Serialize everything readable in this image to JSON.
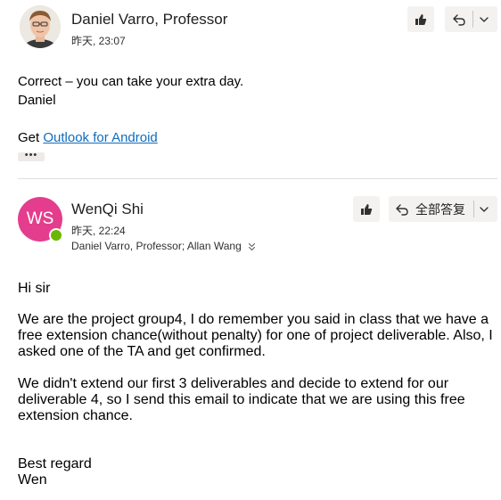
{
  "message1": {
    "sender": "Daniel Varro, Professor",
    "time": "昨天, 23:07",
    "body_line1": "Correct – you can take your extra day.",
    "body_line2": "Daniel",
    "get_prefix": "Get ",
    "link_text": "Outlook for Android",
    "ellipsis": "•••"
  },
  "message2": {
    "avatar_initials": "WS",
    "sender": "WenQi Shi",
    "time": "昨天, 22:24",
    "recipients": "Daniel Varro, Professor; Allan Wang",
    "reply_all_label": "全部答复",
    "greeting": "Hi sir",
    "para1": "We are the project group4, I do remember you said in class that we have a\nfree extension chance(without penalty) for one of project deliverable. Also, I\nasked one of the TA and get confirmed.",
    "para2": "We didn't extend our first 3 deliverables and decide to extend for our\ndeliverable 4, so I send this email to indicate that we are using this free\nextension chance.",
    "closing1": "Best regard",
    "closing2": "Wen"
  },
  "icons": {
    "like": "thumbs-up-icon",
    "reply": "reply-icon",
    "more": "chevron-down-icon",
    "expand": "double-chevron-down-icon"
  },
  "colors": {
    "ws_avatar": "#e43d8e",
    "presence": "#6bb700",
    "link": "#0f6cbd"
  }
}
